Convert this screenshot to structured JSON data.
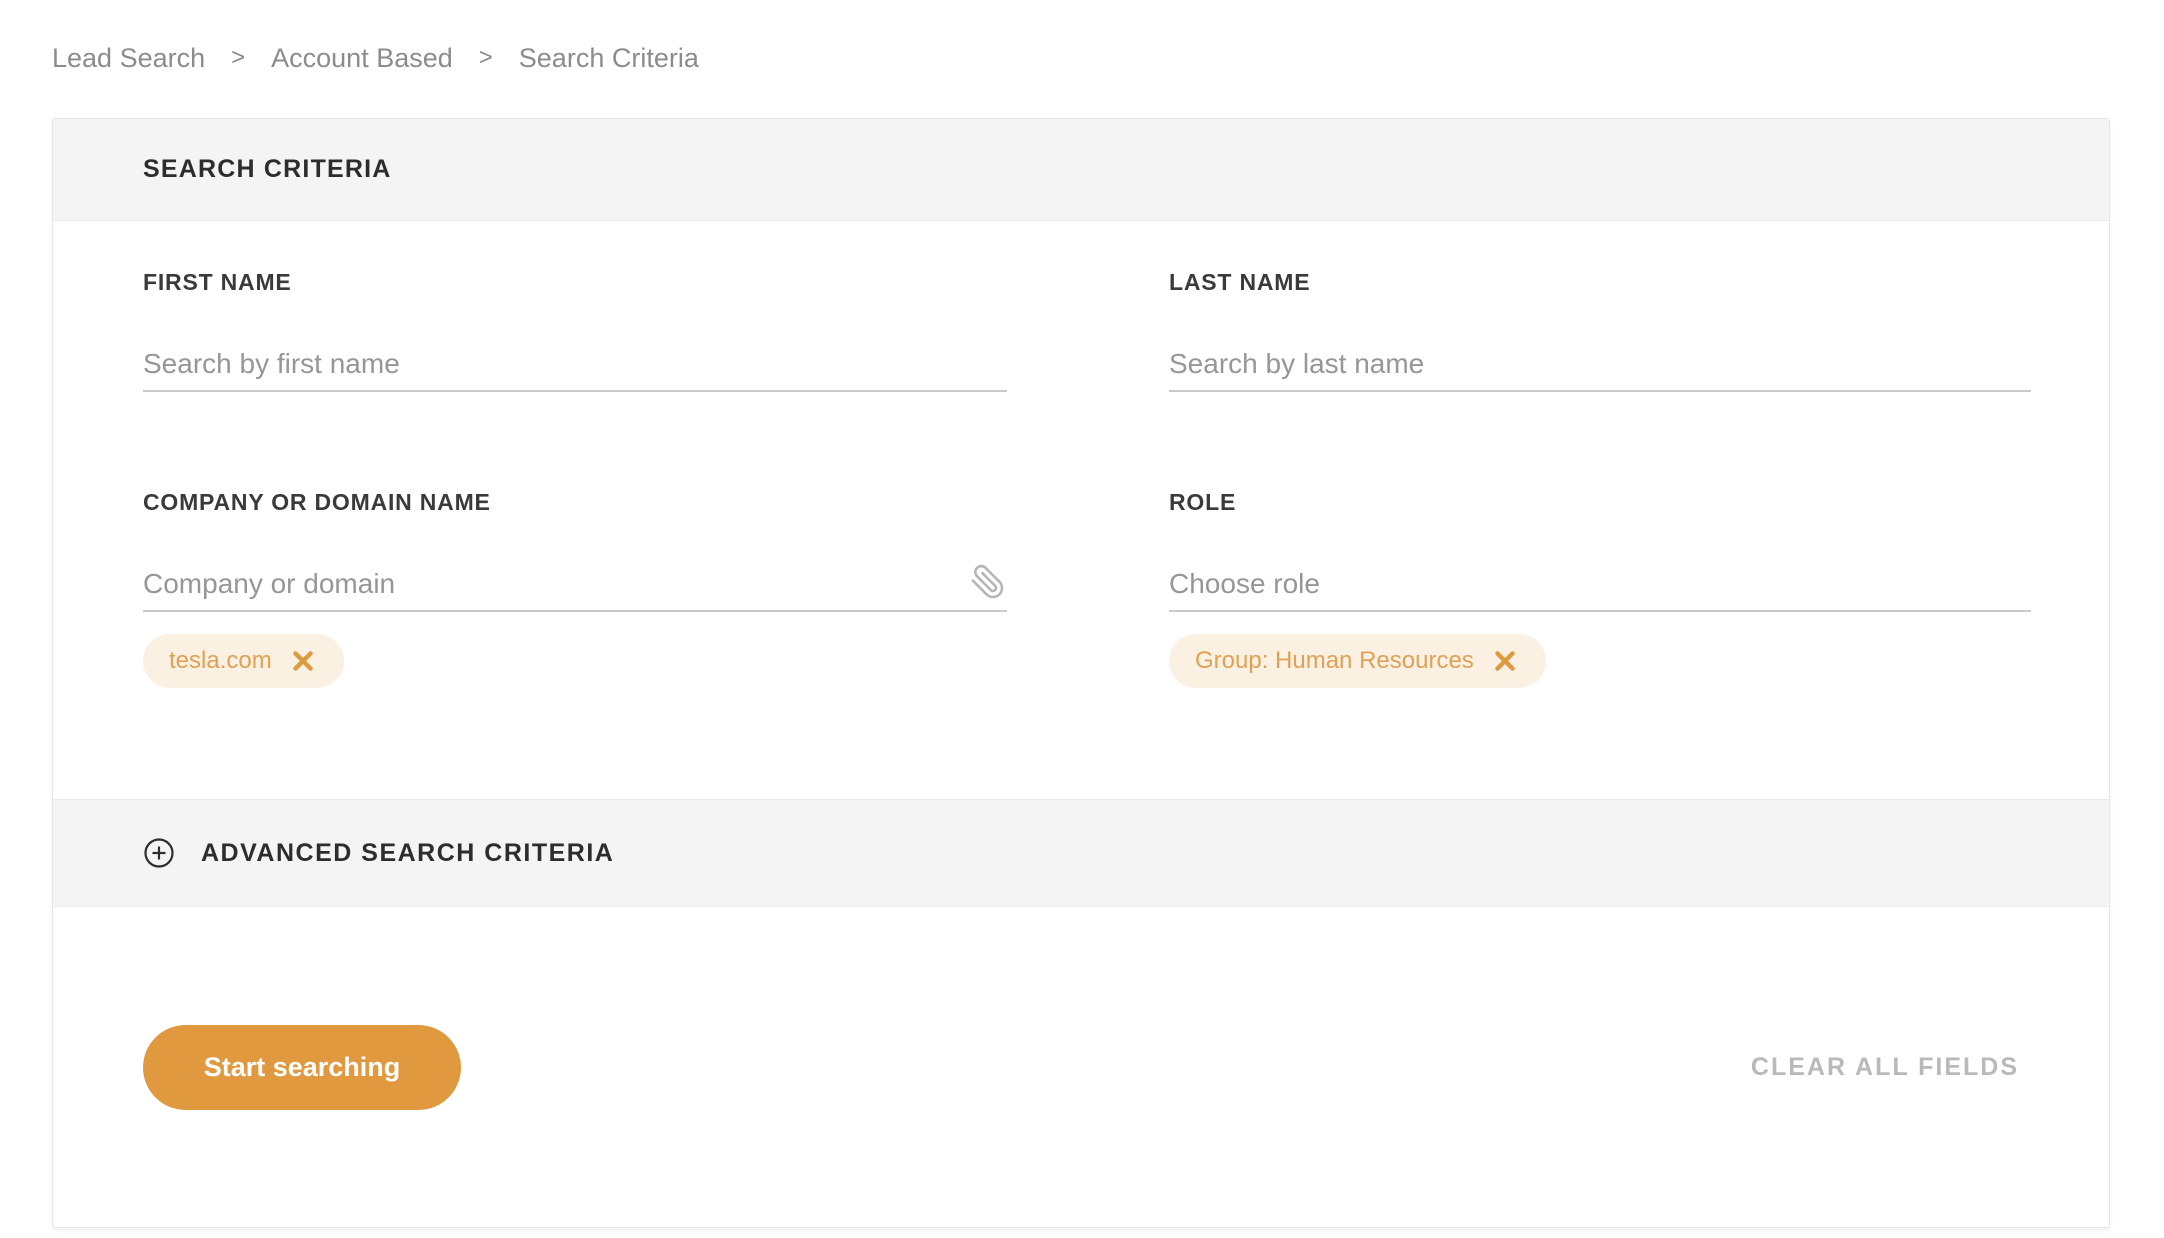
{
  "breadcrumb": {
    "separator": ">",
    "items": [
      "Lead Search",
      "Account Based",
      "Search Criteria"
    ]
  },
  "panel": {
    "title": "SEARCH CRITERIA",
    "fields": {
      "first_name": {
        "label": "FIRST NAME",
        "placeholder": "Search by first name",
        "value": ""
      },
      "last_name": {
        "label": "LAST NAME",
        "placeholder": "Search by last name",
        "value": ""
      },
      "company": {
        "label": "COMPANY OR DOMAIN NAME",
        "placeholder": "Company or domain",
        "value": "",
        "tag": "tesla.com"
      },
      "role": {
        "label": "ROLE",
        "placeholder": "Choose role",
        "value": "",
        "tag": "Group: Human Resources"
      }
    },
    "advanced": {
      "label": "ADVANCED SEARCH CRITERIA"
    },
    "footer": {
      "start_button": "Start searching",
      "clear_button": "CLEAR ALL FIELDS"
    }
  },
  "colors": {
    "accent_orange": "#e0993f",
    "tag_background": "#faf1e3",
    "tag_text": "#e0a155",
    "tag_x": "#dd9a3f",
    "band_background": "#f5f4f4"
  }
}
